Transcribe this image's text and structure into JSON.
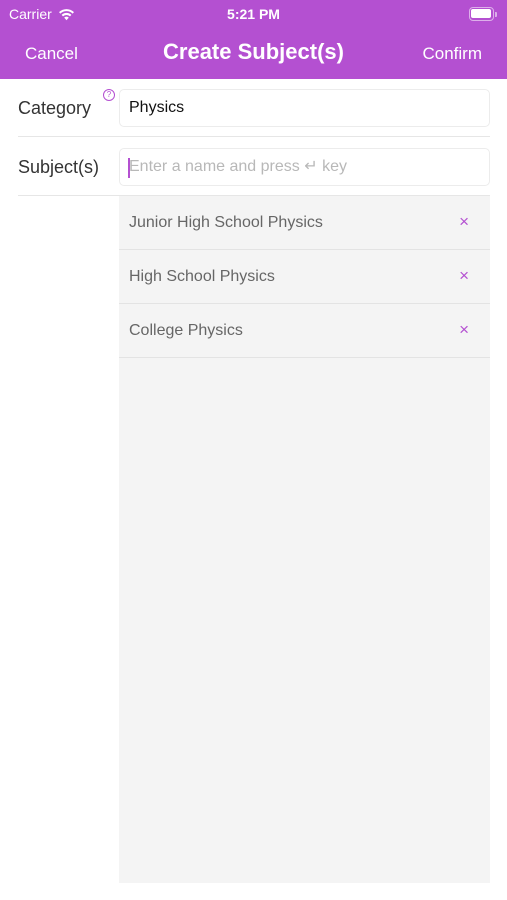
{
  "status_bar": {
    "carrier": "Carrier",
    "time": "5:21 PM",
    "wifi_icon": "wifi-icon",
    "battery_icon": "battery-icon"
  },
  "nav": {
    "cancel_label": "Cancel",
    "title": "Create Subject(s)",
    "confirm_label": "Confirm"
  },
  "form": {
    "category_label": "Category",
    "category_help_icon": "question-mark-icon",
    "category_help_glyph": "?",
    "category_value": "Physics",
    "subjects_label": "Subject(s)",
    "subjects_placeholder": "Enter a name and press ↵ key",
    "subjects_value": ""
  },
  "subjects": [
    {
      "name": "Junior High School Physics",
      "remove_glyph": "×"
    },
    {
      "name": "High School Physics",
      "remove_glyph": "×"
    },
    {
      "name": "College Physics",
      "remove_glyph": "×"
    }
  ],
  "colors": {
    "accent": "#b450d1",
    "list_background": "#f4f4f4",
    "label_text": "#333333",
    "list_text": "#666666"
  }
}
